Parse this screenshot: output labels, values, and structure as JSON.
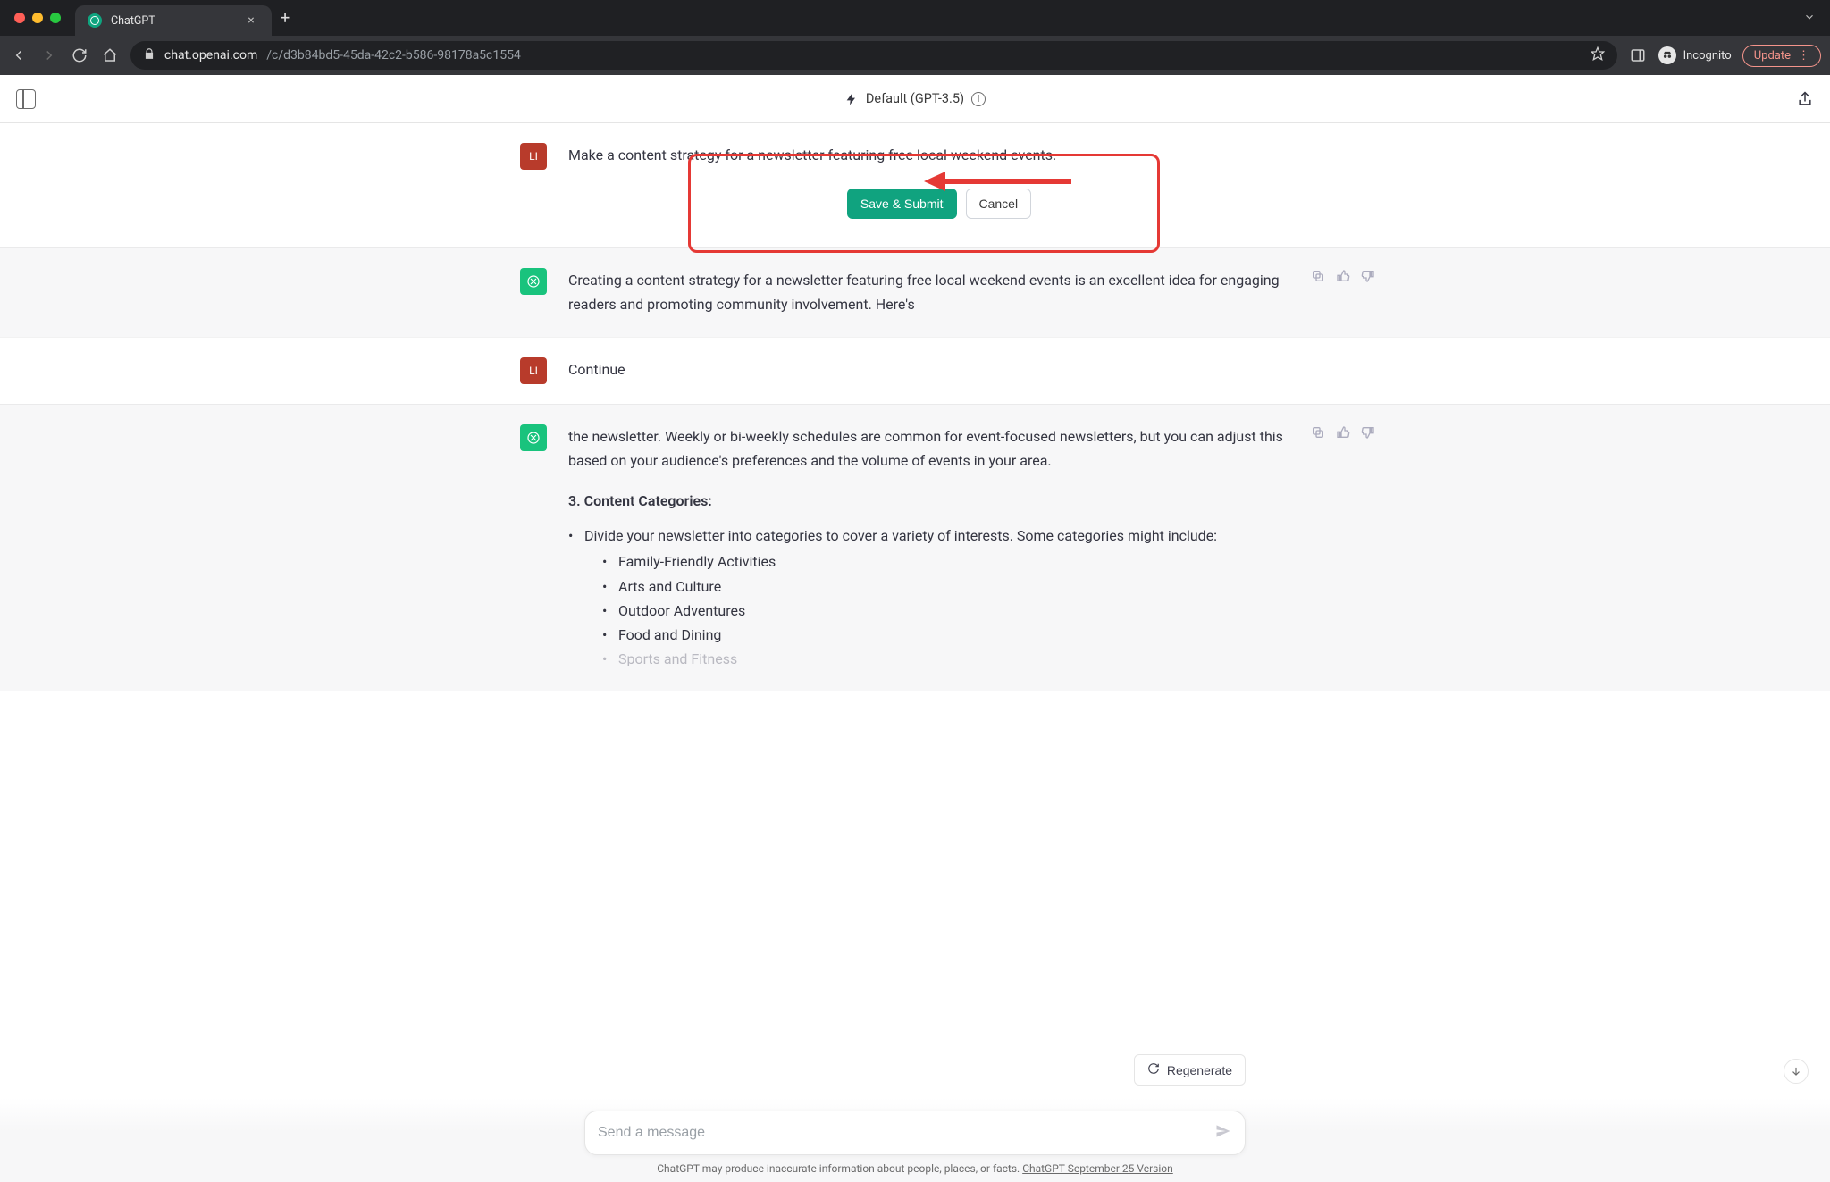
{
  "browser": {
    "tab_title": "ChatGPT",
    "url_host": "chat.openai.com",
    "url_path": "/c/d3b84bd5-45da-42c2-b586-98178a5c1554",
    "incognito_label": "Incognito",
    "update_label": "Update"
  },
  "topbar": {
    "model_label": "Default (GPT-3.5)"
  },
  "messages": {
    "m0": {
      "avatar": "LI",
      "text": "Make a content strategy for a newsletter featuring free local weekend events.",
      "save_label": "Save & Submit",
      "cancel_label": "Cancel"
    },
    "m1": {
      "text": "Creating a content strategy for a newsletter featuring free local weekend events is an excellent idea for engaging readers and promoting community involvement. Here's"
    },
    "m2": {
      "avatar": "LI",
      "text": "Continue"
    },
    "m3": {
      "para": "the newsletter. Weekly or bi-weekly schedules are common for event-focused newsletters, but you can adjust this based on your audience's preferences and the volume of events in your area.",
      "heading": "3. Content Categories:",
      "bullet_intro": "Divide your newsletter into categories to cover a variety of interests. Some categories might include:",
      "cats": {
        "c0": "Family-Friendly Activities",
        "c1": "Arts and Culture",
        "c2": "Outdoor Adventures",
        "c3": "Food and Dining",
        "c4": "Sports and Fitness"
      }
    }
  },
  "footer": {
    "regenerate_label": "Regenerate",
    "placeholder": "Send a message",
    "disclaimer_prefix": "ChatGPT may produce inaccurate information about people, places, or facts. ",
    "disclaimer_link": "ChatGPT September 25 Version"
  }
}
